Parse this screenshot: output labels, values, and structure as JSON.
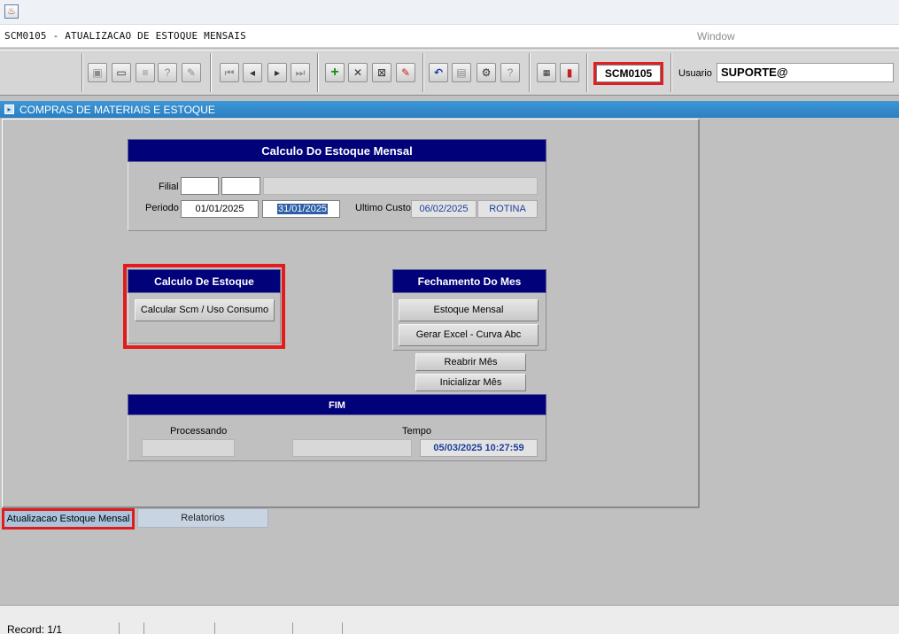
{
  "app": {
    "window_title": "SCM0105 - ATUALIZACAO DE ESTOQUE MENSAIS",
    "window_menu": "Window"
  },
  "toolbar": {
    "form_code": "SCM0105",
    "usuario_label": "Usuario",
    "usuario_value": "SUPORTE@",
    "icons": [
      "save-icon",
      "screen-icon",
      "print-icon",
      "query-icon",
      "query-edit-icon",
      "first-record-icon",
      "prev-record-icon",
      "next-record-icon",
      "last-record-icon",
      "insert-record-icon",
      "delete-record-icon",
      "clear-icon",
      "edit-icon",
      "undo-icon",
      "clipboard-icon",
      "tools-icon",
      "help-icon",
      "menu-icon",
      "exit-icon"
    ]
  },
  "module": {
    "title": "COMPRAS DE MATERIAIS E ESTOQUE"
  },
  "calc_frame": {
    "title": "Calculo Do Estoque Mensal",
    "filial_label": "Filial",
    "filial_1": "",
    "filial_2": "",
    "filial_desc": "",
    "periodo_label": "Periodo",
    "periodo_inicio": "01/01/2025",
    "periodo_fim": "31/01/2025",
    "ultimo_custo_label": "Ultimo Custo",
    "ultimo_custo_value": "06/02/2025",
    "rotina": "ROTINA"
  },
  "calculo_estoque": {
    "title": "Calculo De Estoque",
    "button": "Calcular Scm / Uso Consumo"
  },
  "fechamento": {
    "title": "Fechamento Do Mes",
    "estoque_mensal": "Estoque Mensal",
    "gerar_excel": "Gerar Excel - Curva Abc",
    "reabrir": "Reabrir Mês",
    "inicializar": "Inicializar Mês"
  },
  "fim": {
    "title": "FIM",
    "processando_label": "Processando",
    "processando_value": "",
    "tempo_label": "Tempo",
    "tempo_value": "",
    "timestamp": "05/03/2025 10:27:59"
  },
  "tabs": [
    "Atualizacao Estoque Mensal",
    "Relatorios"
  ],
  "status": {
    "record": "Record: 1/1"
  },
  "colors": {
    "frame_title_bg": "#01017a",
    "highlight": "#e21b1b",
    "module_bar": "#2a7fc2"
  }
}
